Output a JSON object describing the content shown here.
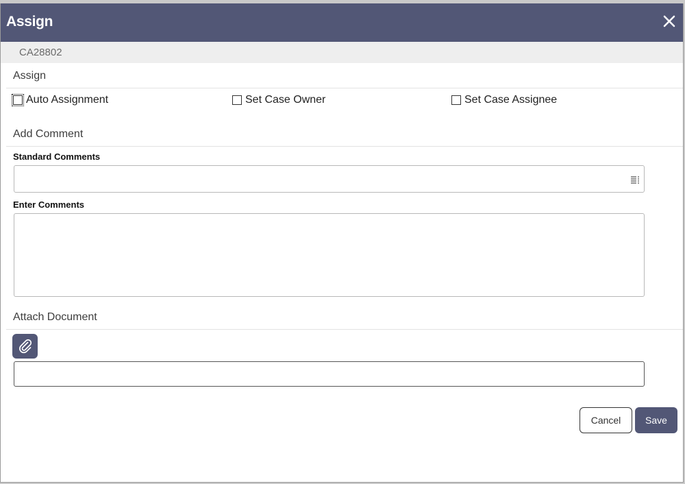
{
  "dialog": {
    "title": "Assign",
    "case_id": "CA28802"
  },
  "assign_section": {
    "title": "Assign",
    "options": [
      {
        "label": "Auto Assignment",
        "checked": false
      },
      {
        "label": "Set Case Owner",
        "checked": false
      },
      {
        "label": "Set Case Assignee",
        "checked": false
      }
    ]
  },
  "comment_section": {
    "title": "Add Comment",
    "standard_comments_label": "Standard Comments",
    "standard_comments_value": "",
    "enter_comments_label": "Enter Comments",
    "enter_comments_value": ""
  },
  "attach_section": {
    "title": "Attach Document",
    "file_value": ""
  },
  "buttons": {
    "cancel": "Cancel",
    "save": "Save"
  },
  "colors": {
    "header_bg": "#525776",
    "band_bg": "#eeeeee"
  },
  "icons": {
    "close": "close-icon",
    "list": "list-icon",
    "attach": "paperclip-icon"
  }
}
